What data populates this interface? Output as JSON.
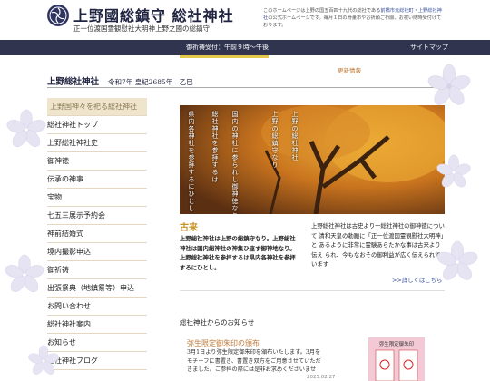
{
  "header": {
    "title": "上野國総鎮守 総社神社",
    "subtitle": "正一位渡国霊観慰社大明神上野之國の総鎮守",
    "note_prefix": "このホームページは上野の国五百四十九代の総社である",
    "note_link": "前橋市元総社町・上野総社神社",
    "note_suffix": "の公式ホームページです。毎月１日の骨董市やお祈願ご祈願、お祓い随時受付けております。"
  },
  "nav": {
    "hours": "御祈祷受付：午前９時〜午後",
    "sitemap": "サイトマップ"
  },
  "page": {
    "name": "上野総社神社",
    "date": "令和7年 皇紀2685年　乙巳",
    "updates_label": "更新情報"
  },
  "sidebar": {
    "items": [
      {
        "label": "上野国神々を祀る総社神社"
      },
      {
        "label": "総社神社トップ"
      },
      {
        "label": "上野総社神社史"
      },
      {
        "label": "御神徳"
      },
      {
        "label": "伝承の神事"
      },
      {
        "label": "宝物"
      },
      {
        "label": "七五三展示予約会"
      },
      {
        "label": "神前結婚式"
      },
      {
        "label": "境内撮影申込"
      },
      {
        "label": "御祈祷"
      },
      {
        "label": "出張祭典（地鎮祭等）申込"
      },
      {
        "label": "お問い合わせ"
      },
      {
        "label": "総社神社案内"
      },
      {
        "label": "お知らせ"
      },
      {
        "label": "総社神社ブログ"
      }
    ]
  },
  "hero": {
    "lines": [
      "上野の総社神社",
      "上野の総鎮守なり",
      "国内の神社に参られし御神徳なり",
      "総社神社を参拝するは",
      "県内各神社を参拝するにひとし"
    ]
  },
  "kotohoku": {
    "title": "古来",
    "body": "上野総社神社は上野の総鎮守なり。上野総社 神社は国内総神社の神集ひ座す御神地なり。 上野総社神社を参拝するは県内各神社を参拝 するにひとし。"
  },
  "intro": {
    "body": "上野総社神社は古史より一総社神社の御神徳について 清和天皇の勅願に「正一位渡国霊観慰社大明神」と あるように非常に霊験あらたかな事は古来より伝え られ、今もなおその御利益が広く伝えられています",
    "more_link": ">>詳しくはこちら"
  },
  "news": {
    "heading": "総社神社からのお知らせ",
    "item_title": "弥生限定御朱印の頒布",
    "item_body": "3月1日より弥生限定御朱印を頒布いたします。3月をモチーフに書置き、書置き双方をご用意させていただきました。ご参拝の際には是非お求めくださいませ",
    "item_date": "2025.02.27",
    "thumb_title": "弥生限定御朱印"
  },
  "colors": {
    "nav_bg": "#30344f",
    "accent_gold": "#c79225",
    "accent_orange": "#c07b3a",
    "link_blue": "#3a55a0",
    "sidebar_active": "#efe4cc"
  }
}
